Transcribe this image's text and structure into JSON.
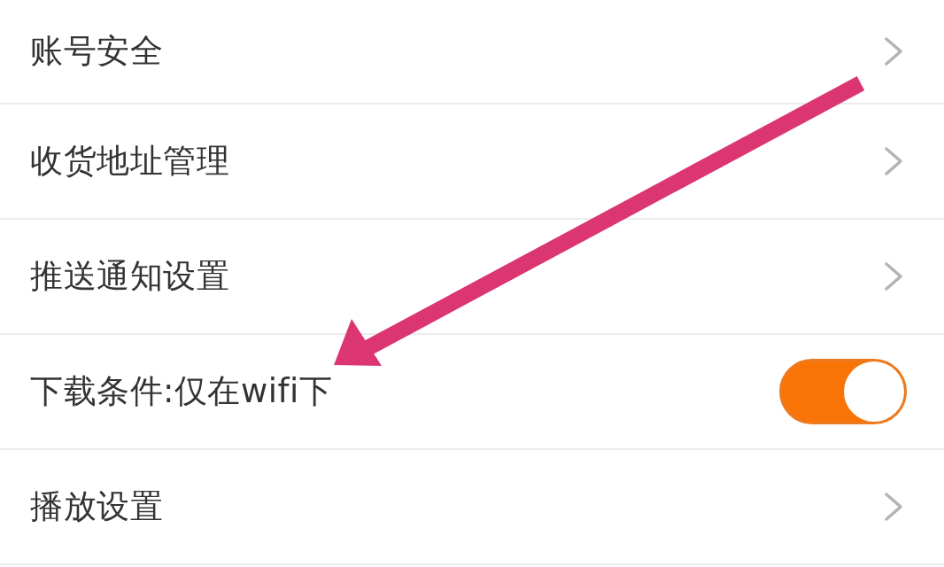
{
  "settings": [
    {
      "kind": "link",
      "label": "账号安全"
    },
    {
      "kind": "link",
      "label": "收货地址管理"
    },
    {
      "kind": "link",
      "label": "推送通知设置"
    },
    {
      "kind": "toggle",
      "label": "下载条件:仅在wifi下",
      "on": true
    },
    {
      "kind": "link",
      "label": "播放设置"
    }
  ]
}
